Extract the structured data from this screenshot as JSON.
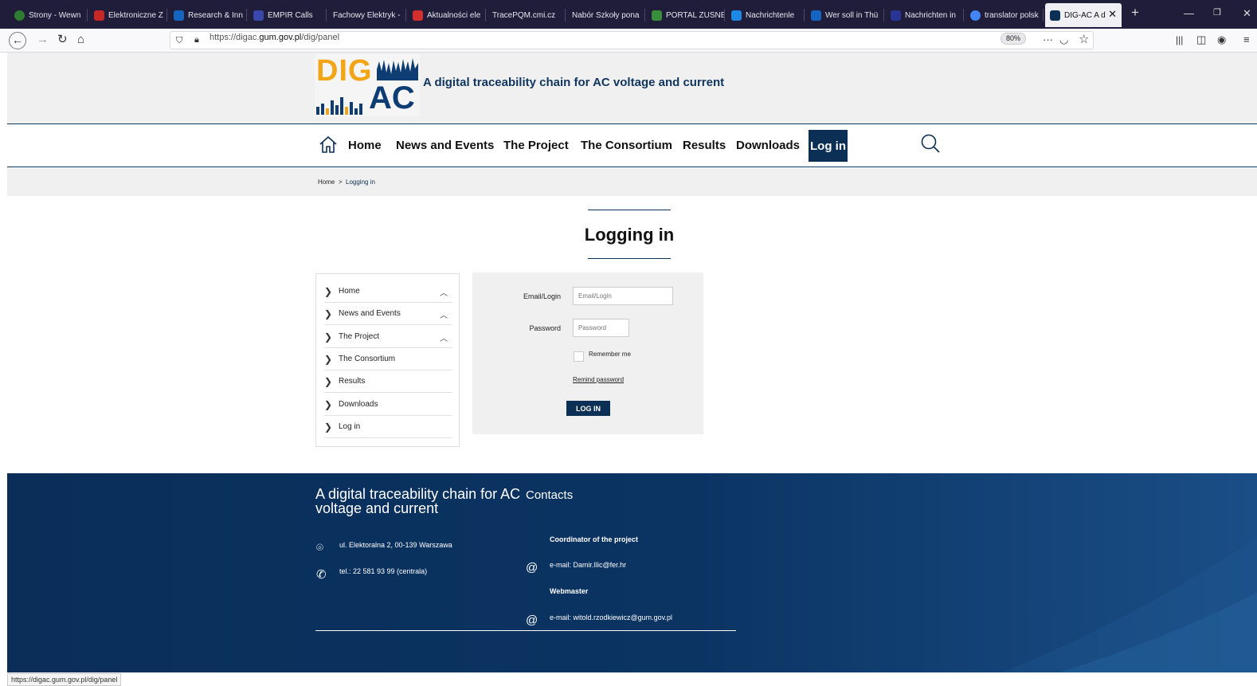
{
  "browser": {
    "tabs": [
      {
        "label": "Strony - Wewn",
        "color": "#2e7d32"
      },
      {
        "label": "Elektroniczne Z",
        "color": "#c62828"
      },
      {
        "label": "Research & Inn",
        "color": "#1565c0"
      },
      {
        "label": "EMPIR Calls",
        "color": "#3949ab"
      },
      {
        "label": "Fachowy Elektryk -",
        "color": "#1f1d3a"
      },
      {
        "label": "Aktualności ele",
        "color": "#d32f2f"
      },
      {
        "label": "TracePQM.cmi.cz",
        "color": "#1f1d3a"
      },
      {
        "label": "Nabór Szkoły pona",
        "color": "#1f1d3a"
      },
      {
        "label": "PORTAL ZUSNE",
        "color": "#388e3c"
      },
      {
        "label": "Nachrichtenle",
        "color": "#1e88e5"
      },
      {
        "label": "Wer soll in Thü",
        "color": "#1565c0"
      },
      {
        "label": "Nachrichten in",
        "color": "#283593"
      },
      {
        "label": "translator polsk",
        "color": "#4285f4"
      },
      {
        "label": "DIG-AC A d",
        "color": "#0b2f55"
      }
    ],
    "new_tab": "+",
    "url_prefix": "https://digac.",
    "url_domain": "gum.gov.pl",
    "url_suffix": "/dig/panel",
    "zoom": "80%",
    "status_url": "https://digac.gum.gov.pl/dig/panel"
  },
  "header": {
    "logo_top": "DIG",
    "logo_bottom": "AC",
    "tagline": "A digital traceability chain for AC voltage and current"
  },
  "nav": {
    "items": [
      "Home",
      "News and Events",
      "The Project",
      "The Consortium",
      "Results",
      "Downloads"
    ],
    "login": "Log in"
  },
  "breadcrumb": {
    "home": "Home",
    "sep": ">",
    "current": "Logging in"
  },
  "page_title": "Logging in",
  "sidemenu": {
    "items": [
      "Home",
      "News and Events",
      "The Project",
      "The Consortium",
      "Results",
      "Downloads",
      "Log in"
    ]
  },
  "form": {
    "email_label": "Email/Login",
    "email_placeholder": "Email/Login",
    "password_label": "Password",
    "password_placeholder": "Password",
    "remember_label": "Remember me",
    "remind_link": "Remind password",
    "submit_label": "LOG IN"
  },
  "footer": {
    "title": "A digital traceability chain for AC voltage and current",
    "contacts_heading": "Contacts",
    "address": "ul. Elektoralna 2, 00-139 Warszawa",
    "phone": "tel.: 22 581 93 99 (centrala)",
    "coordinator_heading": "Coordinator of the project",
    "coordinator_email": "e-mail: Damir.Ilic@fer.hr",
    "webmaster_heading": "Webmaster",
    "webmaster_email": "e-mail: witold.rzodkiewicz@gum.gov.pl"
  }
}
